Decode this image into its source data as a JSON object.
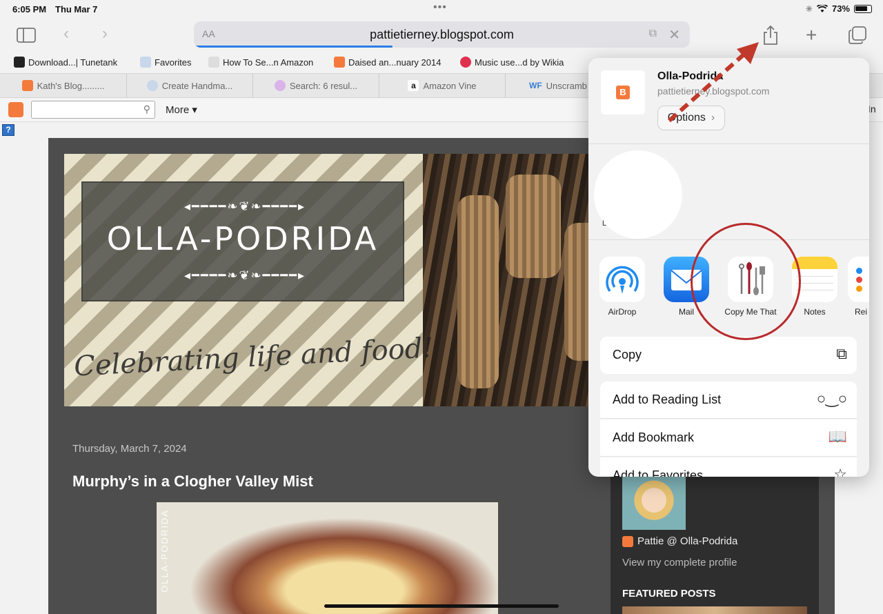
{
  "status": {
    "time": "6:05 PM",
    "date": "Thu Mar 7",
    "battery": "73%"
  },
  "toolbar": {
    "aa": "AA",
    "url": "pattietierney.blogspot.com"
  },
  "bookmarks": [
    {
      "label": "Download...| Tunetank",
      "color": "#222222"
    },
    {
      "label": "Favorites",
      "color": "#9ab4d6"
    },
    {
      "label": "How To Se...n Amazon",
      "color": "#c9c9c9"
    },
    {
      "label": "Daised an...nuary 2014",
      "color": "#f37a3c"
    },
    {
      "label": "Music use...d by Wikia",
      "color": "#e03050"
    }
  ],
  "tabs": [
    {
      "label": "Kath's Blog.........",
      "color": "#f37a3c"
    },
    {
      "label": "Create Handma...",
      "color": "#9ab4d6"
    },
    {
      "label": "Search: 6 resul...",
      "color": "#c88de0"
    },
    {
      "label": "Amazon Vine",
      "color": "#222222"
    },
    {
      "label": "Unscramb",
      "color": "#3a7dd4"
    }
  ],
  "navbar": {
    "more": "More ▾",
    "signin": "In"
  },
  "blog": {
    "title": "OLLA-PODRIDA",
    "tagline": "Celebrating life and food!",
    "post_date": "Thursday, March 7, 2024",
    "post_title": "Murphy’s in a Clogher Valley Mist",
    "image_watermark": "OLLA-PODRIDA"
  },
  "sidebar": {
    "profile_name": "Pattie @ Olla-Podrida",
    "profile_link": "View my complete profile",
    "featured": "FEATURED POSTS"
  },
  "share": {
    "title": "Olla-Podrida",
    "url": "pattietierney.blogspot.com",
    "options": "Options",
    "apps": [
      {
        "label": "AirDrop"
      },
      {
        "label": "Mail"
      },
      {
        "label": "Copy Me That"
      },
      {
        "label": "Notes"
      },
      {
        "label": "Rei"
      }
    ],
    "actions": [
      {
        "label": "Copy"
      },
      {
        "label": "Add to Reading List"
      },
      {
        "label": "Add Bookmark"
      },
      {
        "label": "Add to Favorites"
      }
    ]
  },
  "colors": {
    "accent": "#2b7de9",
    "blogger": "#f37a3c",
    "annotation": "#b82a2a",
    "page_bg": "#4d4d4d"
  }
}
